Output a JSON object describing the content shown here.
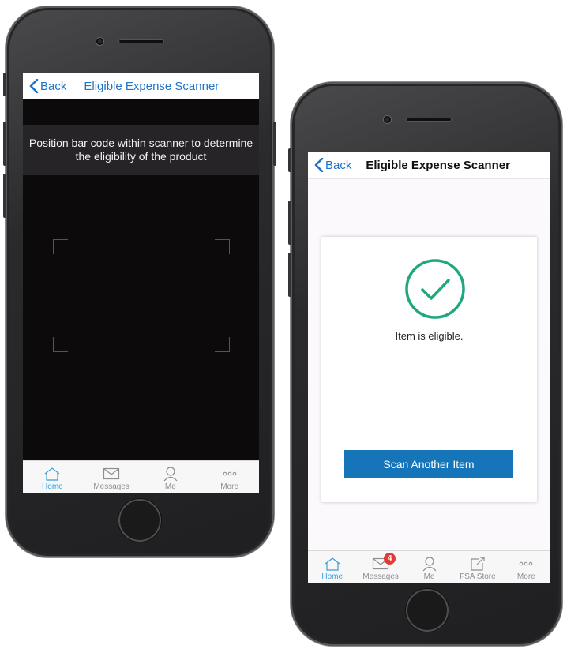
{
  "left_phone": {
    "nav": {
      "back_label": "Back",
      "title": "Eligible Expense Scanner"
    },
    "scanner": {
      "instruction_line1": "Position bar code within scanner to determine",
      "instruction_line2": "the eligibility of the product"
    },
    "tabs": [
      {
        "label": "Home",
        "icon": "home-icon",
        "active": true
      },
      {
        "label": "Messages",
        "icon": "envelope-icon",
        "active": false
      },
      {
        "label": "Me",
        "icon": "person-icon",
        "active": false
      },
      {
        "label": "More",
        "icon": "more-dots-icon",
        "active": false
      }
    ]
  },
  "right_phone": {
    "nav": {
      "back_label": "Back",
      "title": "Eligible Expense Scanner"
    },
    "result": {
      "icon": "checkmark-circle-icon",
      "message": "Item is eligible."
    },
    "scan_button_label": "Scan Another Item",
    "tabs": [
      {
        "label": "Home",
        "icon": "home-icon",
        "active": true
      },
      {
        "label": "Messages",
        "icon": "envelope-icon",
        "active": false,
        "badge": "4"
      },
      {
        "label": "Me",
        "icon": "person-icon",
        "active": false
      },
      {
        "label": "FSA Store",
        "icon": "external-store-icon",
        "active": false
      },
      {
        "label": "More",
        "icon": "more-dots-icon",
        "active": false
      }
    ]
  },
  "colors": {
    "accent_blue": "#1e73c8",
    "active_tab": "#38a0d8",
    "button_blue": "#1675b9",
    "success_green": "#1fa77f",
    "scanner_corner_red": "#c0272d",
    "badge_red": "#e53935"
  }
}
